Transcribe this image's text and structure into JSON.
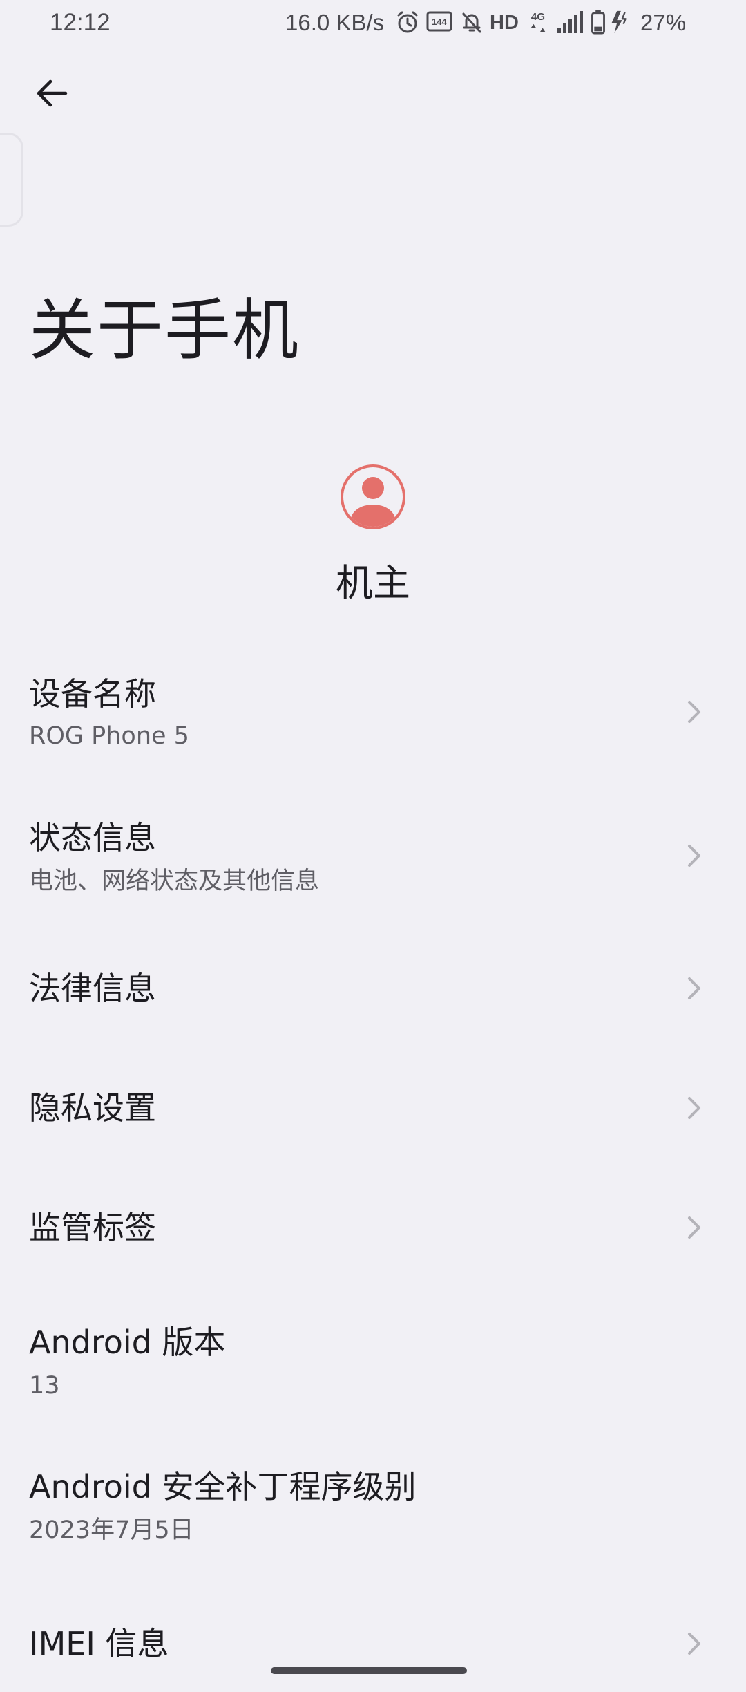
{
  "status_bar": {
    "time": "12:12",
    "network_speed": "16.0 KB/s",
    "refresh_rate": "144",
    "network_type": "4G",
    "hd_label": "HD",
    "battery_percent": "27%",
    "icons": [
      "alarm-icon",
      "refresh-rate-icon",
      "mute-icon",
      "hd-icon",
      "4g-icon",
      "signal-icon",
      "battery-icon",
      "charging-icon"
    ]
  },
  "header": {
    "title": "关于手机"
  },
  "owner": {
    "name": "机主",
    "avatar_color": "#e4706b"
  },
  "settings": {
    "items": [
      {
        "title": "设备名称",
        "subtitle": "ROG Phone 5",
        "chevron": true
      },
      {
        "title": "状态信息",
        "subtitle": "电池、网络状态及其他信息",
        "chevron": true
      },
      {
        "title": "法律信息",
        "subtitle": "",
        "chevron": true
      },
      {
        "title": "隐私设置",
        "subtitle": "",
        "chevron": true
      },
      {
        "title": "监管标签",
        "subtitle": "",
        "chevron": true
      },
      {
        "title": "Android 版本",
        "subtitle": "13",
        "chevron": false
      },
      {
        "title": "Android 安全补丁程序级别",
        "subtitle": "2023年7月5日",
        "chevron": false
      },
      {
        "title": "IMEI 信息",
        "subtitle": "",
        "chevron": true
      }
    ]
  },
  "colors": {
    "background": "#f1f0f5",
    "text_primary": "#1d1c21",
    "text_secondary": "#5f5e65",
    "chevron": "#b4b3b9",
    "accent": "#e4706b"
  }
}
